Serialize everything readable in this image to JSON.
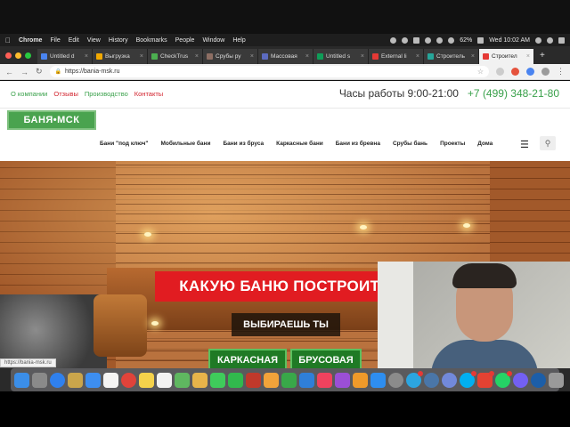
{
  "menubar": {
    "app_name": "Chrome",
    "items": [
      "File",
      "Edit",
      "View",
      "History",
      "Bookmarks",
      "People",
      "Window",
      "Help"
    ],
    "battery": "62%",
    "datetime": "Wed 10:02 AM"
  },
  "tabs": [
    {
      "label": "Untitled d",
      "color": "#4a84f0"
    },
    {
      "label": "Выгрузка",
      "color": "#f2a900"
    },
    {
      "label": "CheckTrus",
      "color": "#4caf50"
    },
    {
      "label": "Срубы ру",
      "color": "#8d6e63"
    },
    {
      "label": "Массовая",
      "color": "#5c6bc0"
    },
    {
      "label": "Untitled s",
      "color": "#0f9d58"
    },
    {
      "label": "External li",
      "color": "#e53935"
    },
    {
      "label": "Строитель",
      "color": "#26a69a"
    },
    {
      "label": "Строител",
      "color": "#e53935",
      "active": true
    }
  ],
  "toolbar": {
    "url": "https://bania-msk.ru"
  },
  "site": {
    "toplinks": [
      {
        "label": "О компании",
        "highlight": false
      },
      {
        "label": "Отзывы",
        "highlight": true
      },
      {
        "label": "Производство",
        "highlight": false
      },
      {
        "label": "Контакты",
        "highlight": false
      }
    ],
    "hours": "Часы работы  9:00-21:00",
    "phone": "+7 (499) 348-21-80",
    "logo": "БАНЯ•МСК",
    "nav": [
      "Бани \"под ключ\"",
      "Мобильные бани",
      "Бани из бруса",
      "Каркасные бани",
      "Бани из бревна",
      "Срубы бань",
      "Проекты",
      "Дома"
    ],
    "hero": {
      "headline": "КАКУЮ БАНЮ ПОСТРОИТЬ",
      "subheadline": "ВЫБИРАЕШЬ ТЫ",
      "option1": "КАРКАСНАЯ",
      "option2": "БРУСОВАЯ"
    },
    "status_url": "https://bania-msk.ru"
  },
  "dock": {
    "icons": [
      {
        "name": "finder-icon",
        "color": "#3b8ee8"
      },
      {
        "name": "launchpad-icon",
        "color": "#8a8a8a"
      },
      {
        "name": "safari-icon",
        "color": "#2f80ed"
      },
      {
        "name": "notes-icon",
        "color": "#caa54b"
      },
      {
        "name": "mail-icon",
        "color": "#3d8ef0"
      },
      {
        "name": "calendar-icon",
        "color": "#f4f4f4"
      },
      {
        "name": "chrome-icon",
        "color": "#e0433a"
      },
      {
        "name": "stickies-icon",
        "color": "#f5d24b"
      },
      {
        "name": "reminders-icon",
        "color": "#f2f2f2"
      },
      {
        "name": "maps-icon",
        "color": "#5fb760"
      },
      {
        "name": "photos-icon",
        "color": "#e8b44a"
      },
      {
        "name": "messages-icon",
        "color": "#3fcb5b"
      },
      {
        "name": "facetime-icon",
        "color": "#31b94d"
      },
      {
        "name": "photo-booth-icon",
        "color": "#c0392b"
      },
      {
        "name": "pages-icon",
        "color": "#f2a33a"
      },
      {
        "name": "numbers-icon",
        "color": "#39a849"
      },
      {
        "name": "keynote-icon",
        "color": "#2f7fd8"
      },
      {
        "name": "music-icon",
        "color": "#f0425e"
      },
      {
        "name": "podcasts-icon",
        "color": "#9b4fd6"
      },
      {
        "name": "books-icon",
        "color": "#f09a2a"
      },
      {
        "name": "app-store-icon",
        "color": "#2e8ef0"
      },
      {
        "name": "system-preferences-icon",
        "color": "#8b8b8b"
      },
      {
        "name": "telegram-icon",
        "color": "#2ca5e0"
      },
      {
        "name": "vk-icon",
        "color": "#4a76a8"
      },
      {
        "name": "discord-icon",
        "color": "#7289da"
      },
      {
        "name": "skype-icon",
        "color": "#00aff0"
      },
      {
        "name": "todoist-icon",
        "color": "#e44232"
      },
      {
        "name": "whatsapp-icon",
        "color": "#25d366"
      },
      {
        "name": "viber-icon",
        "color": "#7360f2"
      },
      {
        "name": "quicktime-icon",
        "color": "#1c5ea8"
      },
      {
        "name": "trash-icon",
        "color": "#9a9a9a"
      }
    ]
  },
  "colors": {
    "brand_green": "#3aa14b",
    "accent_red": "#e11c21",
    "dark_green_button": "#1f7a25"
  }
}
